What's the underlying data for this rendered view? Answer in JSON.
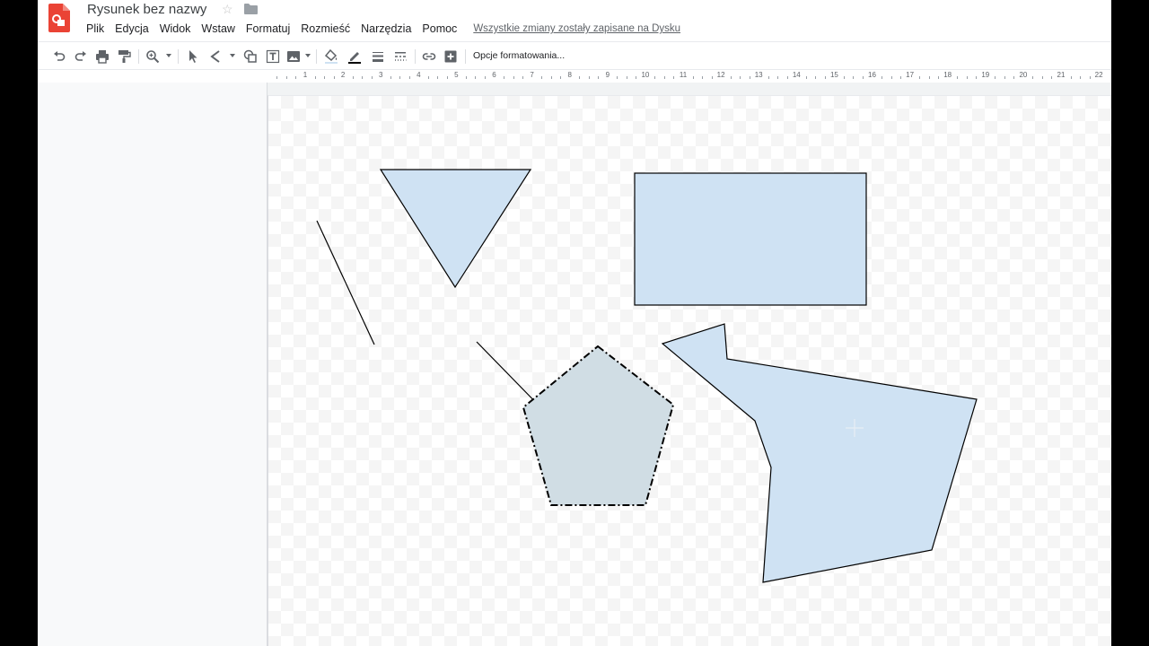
{
  "app": {
    "title": "Rysunek bez nazwy",
    "save_status": "Wszystkie zmiany zostały zapisane na Dysku",
    "accent_color": "#ea4335"
  },
  "menu": [
    "Plik",
    "Edycja",
    "Widok",
    "Wstaw",
    "Formatuj",
    "Rozmieść",
    "Narzędzia",
    "Pomoc"
  ],
  "toolbar": {
    "icons": [
      "undo-icon",
      "redo-icon",
      "print-icon",
      "paint-format-icon",
      "zoom-icon",
      "select-icon",
      "line-icon",
      "shape-icon",
      "text-box-icon",
      "image-icon",
      "fill-color-icon",
      "border-color-icon",
      "border-weight-icon",
      "border-dash-icon",
      "link-icon",
      "add-comment-icon"
    ],
    "format_options": "Opcje formatowania..."
  },
  "ruler": {
    "labels": [
      "1",
      "2",
      "3",
      "4",
      "5",
      "6",
      "7",
      "8",
      "9",
      "10",
      "11",
      "12",
      "13",
      "14",
      "15",
      "16",
      "17",
      "18",
      "19",
      "20",
      "21",
      "22"
    ]
  },
  "shapes": {
    "fill_color": "#cfe2f3",
    "pentagon_fill": "#d0dde4",
    "stroke_color": "#000000"
  }
}
